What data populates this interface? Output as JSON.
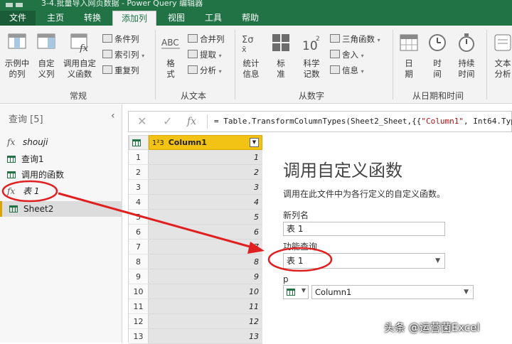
{
  "window": {
    "title": "3-4.批量导入网页数据 - Power Query 编辑器"
  },
  "tabs": [
    {
      "label": "文件"
    },
    {
      "label": "主页"
    },
    {
      "label": "转换"
    },
    {
      "label": "添加列"
    },
    {
      "label": "视图"
    },
    {
      "label": "工具"
    },
    {
      "label": "帮助"
    }
  ],
  "ribbon": {
    "general": {
      "example_col": [
        "示例中",
        "的列"
      ],
      "custom_col": [
        "自定",
        "义列"
      ],
      "invoke_fn": [
        "调用自定",
        "义函数"
      ],
      "conditional": "条件列",
      "index": "索引列",
      "duplicate": "重复列",
      "group": "常规"
    },
    "text": {
      "format": [
        "格",
        "式"
      ],
      "merge": "合并列",
      "extract": "提取",
      "parse": "分析",
      "group": "从文本"
    },
    "number": {
      "stats": [
        "统计",
        "信息"
      ],
      "standard": [
        "标",
        "准"
      ],
      "scientific": [
        "科学",
        "记数"
      ],
      "trig": "三角函数",
      "rounding": "舍入",
      "info": "信息",
      "group": "从数字"
    },
    "datetime": {
      "date": [
        "日",
        "期"
      ],
      "time": [
        "时",
        "间"
      ],
      "duration": [
        "持续",
        "时间"
      ],
      "group": "从日期和时间"
    },
    "ai": {
      "text_analytics": [
        "文本",
        "分析"
      ]
    }
  },
  "queries": {
    "header": "查询 [5]",
    "items": [
      {
        "label": "shouji",
        "icon": "function-icon"
      },
      {
        "label": "查询1",
        "icon": "table-icon"
      },
      {
        "label": "调用的函数",
        "icon": "table-icon"
      },
      {
        "label": "表 1",
        "icon": "function-icon"
      },
      {
        "label": "Sheet2",
        "icon": "table-icon"
      }
    ]
  },
  "formula_bar": {
    "prefix": "= Table.TransformColumnTypes(Sheet2_Sheet,{{",
    "string": "\"Column1\"",
    "suffix": ", Int64.Typ"
  },
  "grid": {
    "column_type": "1²3",
    "column_name": "Column1",
    "rows": [
      {
        "n": "1",
        "v": "1"
      },
      {
        "n": "2",
        "v": "2"
      },
      {
        "n": "3",
        "v": "3"
      },
      {
        "n": "4",
        "v": "4"
      },
      {
        "n": "5",
        "v": "5"
      },
      {
        "n": "6",
        "v": "6"
      },
      {
        "n": "7",
        "v": "7"
      },
      {
        "n": "8",
        "v": "8"
      },
      {
        "n": "9",
        "v": "9"
      },
      {
        "n": "10",
        "v": "10"
      },
      {
        "n": "11",
        "v": "11"
      },
      {
        "n": "12",
        "v": "12"
      },
      {
        "n": "13",
        "v": "13"
      }
    ]
  },
  "panel": {
    "title": "调用自定义函数",
    "description": "调用在此文件中为各行定义的自定义函数。",
    "new_col_label": "新列名",
    "new_col_value": "表 1",
    "fn_query_label": "功能查询",
    "fn_query_value": "表 1",
    "param_label": "p",
    "param_value": "Column1"
  },
  "watermark": "头条 @运营菌Excel",
  "colors": {
    "brand": "#217346",
    "highlight": "#f2c314",
    "annotation": "#e02020"
  }
}
